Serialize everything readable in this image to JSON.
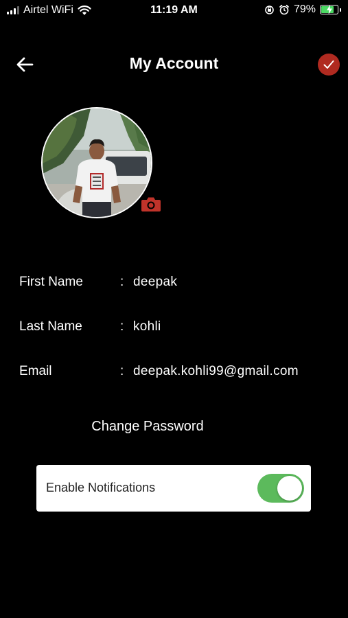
{
  "status_bar": {
    "carrier": "Airtel WiFi",
    "time": "11:19 AM",
    "battery_text": "79%",
    "battery_level": 0.79,
    "icons": [
      "signal-icon",
      "wifi-icon",
      "orientation-lock-icon",
      "alarm-icon",
      "battery-icon"
    ]
  },
  "header": {
    "title": "My Account",
    "back_icon": "arrow-left-icon",
    "save_icon": "checkmark-icon"
  },
  "profile": {
    "camera_icon": "camera-icon"
  },
  "fields": [
    {
      "label": "First Name",
      "colon": ":",
      "value": "deepak"
    },
    {
      "label": "Last Name",
      "colon": ":",
      "value": "kohli"
    },
    {
      "label": "Email",
      "colon": ":",
      "value": "deepak.kohli99@gmail.com"
    }
  ],
  "actions": {
    "change_password": "Change Password"
  },
  "notifications": {
    "label": "Enable Notifications",
    "enabled": true
  },
  "colors": {
    "background": "#000000",
    "accent_red": "#b02a20",
    "toggle_on": "#5cba5c",
    "battery_green": "#4cd964"
  }
}
